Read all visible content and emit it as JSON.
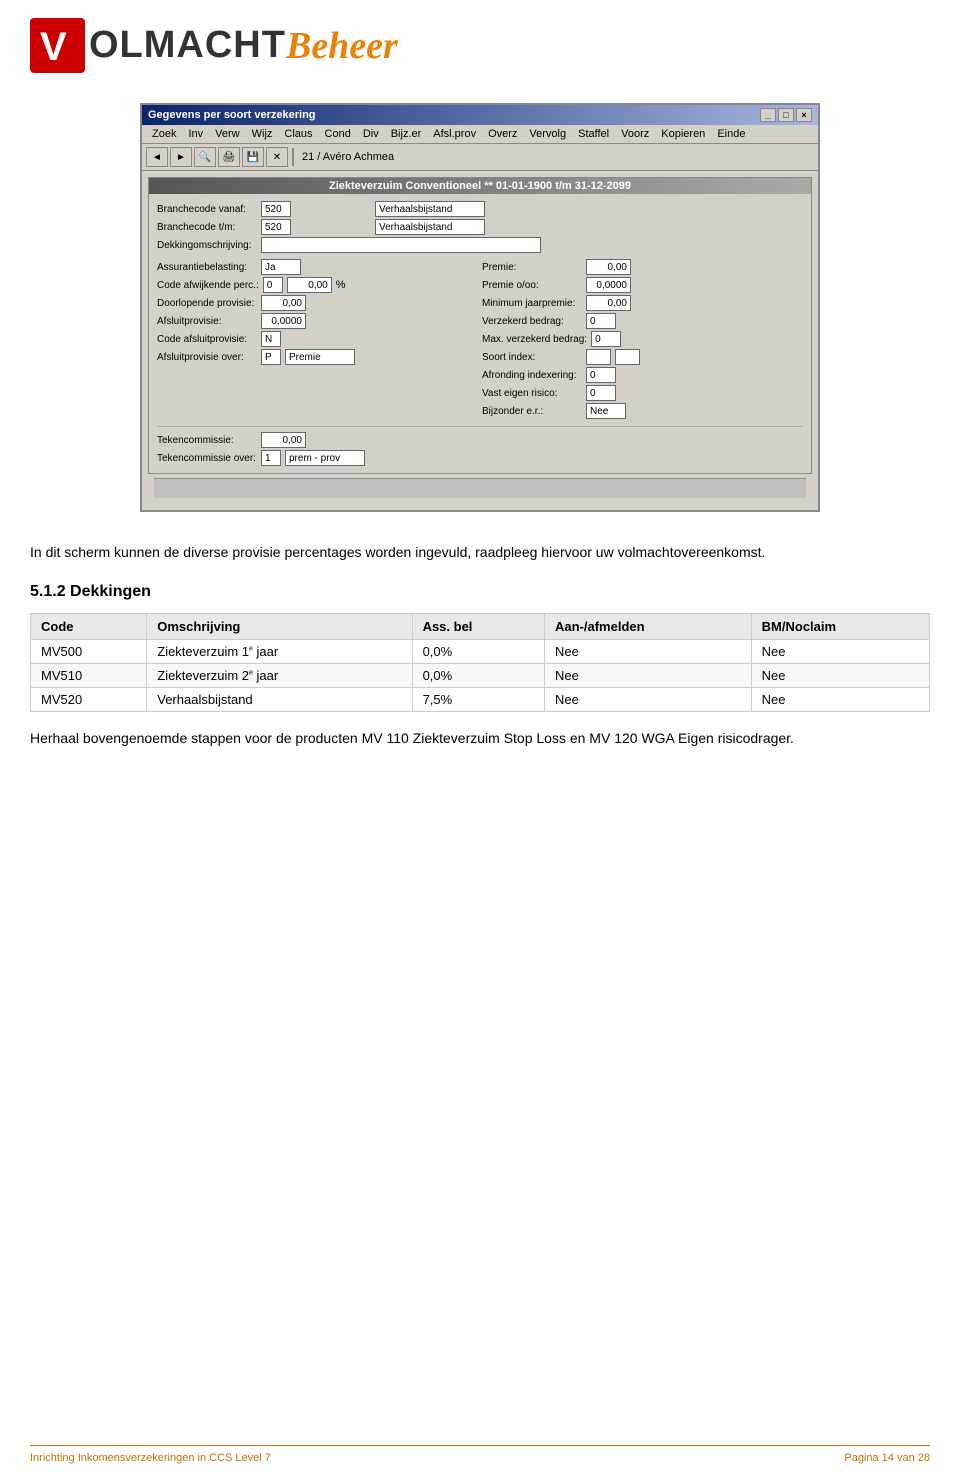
{
  "header": {
    "logo_v_text": "V",
    "logo_olmacht": "OLMACHT",
    "logo_beheer": "Beheer"
  },
  "dialog": {
    "title": "Gegevens per soort verzekering",
    "title_buttons": [
      "_",
      "□",
      "×"
    ],
    "menubar": [
      "Zoek",
      "Inv",
      "Verw",
      "Wijz",
      "Claus",
      "Cond",
      "Div",
      "Bijz.er",
      "Afsl.prov",
      "Overz",
      "Vervolg",
      "Staffel",
      "Voorz",
      "Kopieren",
      "Einde"
    ],
    "toolbar_label": "21 / Avéro Achmea",
    "panel_title": "Ziekteverzuim Conventioneel ** 01-01-1900 t/m 31-12-2099",
    "fields": {
      "left": [
        {
          "label": "Branchecode vanaf:",
          "value": "520",
          "value2": "Verhaalsbijstand"
        },
        {
          "label": "Branchecode t/m:",
          "value": "520",
          "value2": "Verhaalsbijstand"
        },
        {
          "label": "Dekkingomschrijving:",
          "value": ""
        },
        {
          "label": "Assurantiebelasting:",
          "value": "Ja"
        },
        {
          "label": "Code afwijkende perc.:",
          "value": "0",
          "value2": "0,00",
          "suffix": "%"
        },
        {
          "label": "Doorlopende provisie:",
          "value": "0,00"
        },
        {
          "label": "Afsluitprovisie:",
          "value": "0,0000"
        },
        {
          "label": "Code afsluitprovisie:",
          "value": "N"
        },
        {
          "label": "Afsluitprovisie over:",
          "value": "P",
          "value2": "Premie"
        }
      ],
      "right": [
        {
          "label": "Premie:",
          "value": "0,00"
        },
        {
          "label": "Premie o/oo:",
          "value": "0,0000"
        },
        {
          "label": "Minimum jaarpremie:",
          "value": "0,00"
        },
        {
          "label": "Verzekerd bedrag:",
          "value": "0"
        },
        {
          "label": "Max. verzekerd bedrag:",
          "value": "0"
        },
        {
          "label": "Soort index:",
          "value": ""
        },
        {
          "label": "Afronding indexering:",
          "value": "0"
        },
        {
          "label": "Vast eigen risico:",
          "value": "0"
        },
        {
          "label": "Bijzonder e.r.:",
          "value": "Nee"
        }
      ]
    },
    "bottom_fields": [
      {
        "label": "Tekencommissie:",
        "value": "0,00"
      },
      {
        "label": "Tekencommissie over:",
        "value": "1",
        "value2": "prem - prov"
      }
    ]
  },
  "body_text": "In dit scherm kunnen de diverse provisie percentages worden ingevuld, raadpleeg hiervoor uw volmachtovereenkomst.",
  "section": {
    "heading": "5.1.2 Dekkingen",
    "table": {
      "headers": [
        "Code",
        "Omschrijving",
        "Ass. bel",
        "Aan-/afmelden",
        "BM/Noclaim"
      ],
      "rows": [
        {
          "code": "MV500",
          "omschrijving": "Ziekteverzuim 1",
          "superscript": "e",
          "rest": " jaar",
          "ass_bel": "0,0%",
          "aan_afmelden": "Nee",
          "bm_noclaim": "Nee"
        },
        {
          "code": "MV510",
          "omschrijving": "Ziekteverzuim 2",
          "superscript": "e",
          "rest": " jaar",
          "ass_bel": "0,0%",
          "aan_afmelden": "Nee",
          "bm_noclaim": "Nee"
        },
        {
          "code": "MV520",
          "omschrijving": "Verhaalsbijstand",
          "superscript": "",
          "rest": "",
          "ass_bel": "7,5%",
          "aan_afmelden": "Nee",
          "bm_noclaim": "Nee"
        }
      ]
    },
    "follow_text": "Herhaal bovengenoemde stappen voor de producten MV 110 Ziekteverzuim Stop Loss en MV 120 WGA Eigen risicodrager."
  },
  "footer": {
    "left": "Inrichting Inkomensverzekeringen in CCS Level 7",
    "right": "Pagina 14 van 28"
  }
}
